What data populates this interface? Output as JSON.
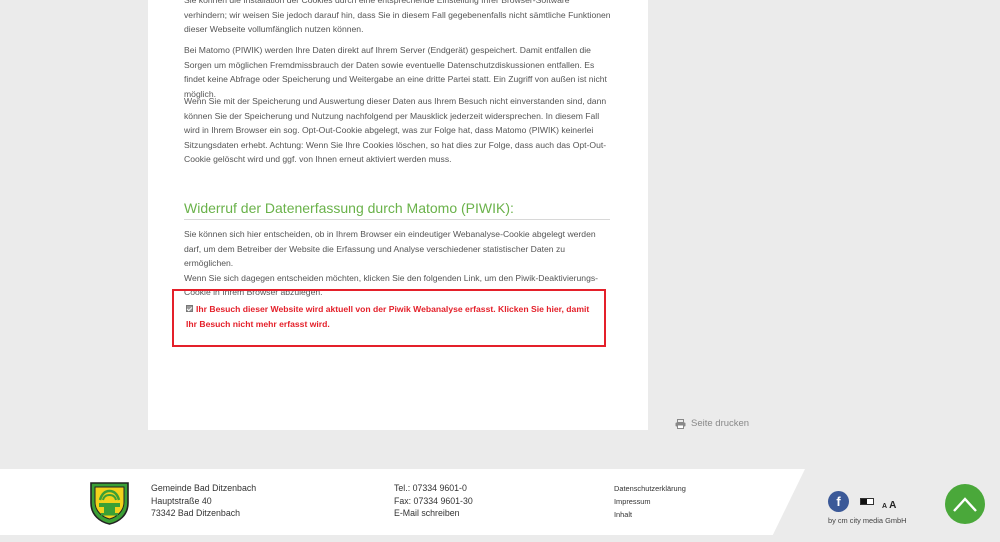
{
  "content": {
    "para1": "Sie können die Installation der Cookies durch eine entsprechende Einstellung Ihrer Browser-Software verhindern; wir weisen Sie jedoch darauf hin, dass Sie in diesem Fall gegebenenfalls nicht sämtliche Funktionen dieser Webseite vollumfänglich nutzen können.",
    "para2": "Bei Matomo (PIWIK) werden Ihre Daten direkt auf Ihrem Server (Endgerät) gespeichert. Damit entfallen die Sorgen um möglichen Fremdmissbrauch der Daten sowie eventuelle Datenschutzdiskussionen entfallen. Es findet keine Abfrage oder Speicherung und Weitergabe an eine dritte Partei statt. Ein Zugriff von außen ist nicht möglich.",
    "para3": "Wenn Sie mit der Speicherung und Auswertung dieser Daten aus Ihrem Besuch nicht einverstanden sind, dann können Sie der Speicherung und Nutzung nachfolgend per Mausklick jederzeit widersprechen. In diesem Fall wird in Ihrem Browser ein sog. Opt-Out-Cookie abgelegt, was zur Folge hat, dass Matomo (PIWIK) keinerlei Sitzungsdaten erhebt. Achtung: Wenn Sie Ihre Cookies löschen, so hat dies zur Folge, dass auch das Opt-Out-Cookie gelöscht wird und ggf. von Ihnen erneut aktiviert werden muss.",
    "heading": "Widerruf der Datenerfassung durch Matomo (PIWIK):",
    "para4_line1": "Sie können sich hier entscheiden, ob in Ihrem Browser ein eindeutiger Webanalyse-Cookie abgelegt werden darf, um dem Betreiber der Website die Erfassung und Analyse verschiedener statistischer Daten zu ermöglichen.",
    "para4_line2": "Wenn Sie sich dagegen entscheiden möchten, klicken Sie den folgenden Link, um den Piwik-Deaktivierungs-Cookie in Ihrem Browser abzulegen.",
    "optout_text": "Ihr Besuch dieser Website wird aktuell von der Piwik Webanalyse erfasst. Klicken Sie hier, damit Ihr Besuch nicht mehr erfasst wird.",
    "optout_checked": true
  },
  "print_label": "Seite drucken",
  "footer": {
    "address": [
      "Gemeinde Bad Ditzenbach",
      "Hauptstraße 40",
      "73342 Bad Ditzenbach"
    ],
    "tel": "Tel.: 07334 9601-0",
    "fax": "Fax: 07334 9601-30",
    "email": "E-Mail schreiben",
    "links": [
      "Datenschutzerklärung",
      "Impressum",
      "Inhalt"
    ],
    "facebook_letter": "f",
    "font_small": "A",
    "font_big": "A",
    "credit": "by cm city media GmbH"
  },
  "colors": {
    "accent_green": "#6ab24a",
    "alert_red": "#e4202a",
    "totop_green": "#4aa83a",
    "facebook_blue": "#3b5998"
  },
  "icons": [
    "print-icon",
    "checkbox-icon",
    "facebook-icon",
    "contrast-icon",
    "chevron-up-icon",
    "crest-logo"
  ]
}
